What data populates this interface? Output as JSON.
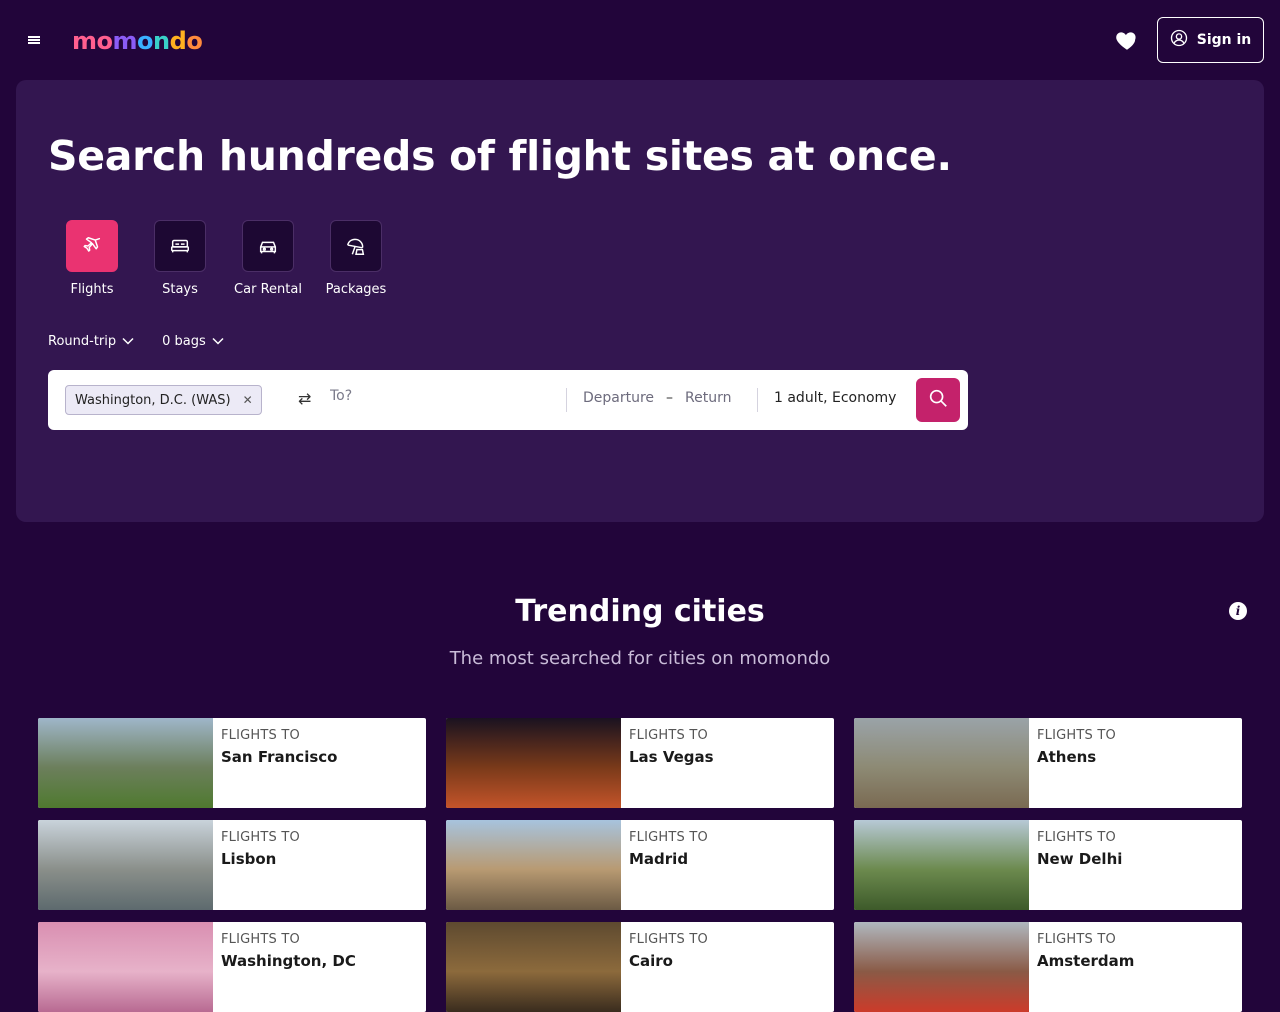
{
  "header": {
    "logo_text": "momondo",
    "logo_colors": [
      "#ff5f8f",
      "#ff5f8f",
      "#8b5cf6",
      "#3ab0ff",
      "#39d0c8",
      "#ffb020",
      "#ff8a3d"
    ],
    "signin_label": "Sign in"
  },
  "hero": {
    "title": "Search hundreds of flight sites at once.",
    "verticals": [
      {
        "label": "Flights",
        "icon": "plane-icon",
        "active": true
      },
      {
        "label": "Stays",
        "icon": "bed-icon",
        "active": false
      },
      {
        "label": "Car Rental",
        "icon": "car-icon",
        "active": false
      },
      {
        "label": "Packages",
        "icon": "beach-umbrella-icon",
        "active": false
      }
    ],
    "trip_type": "Round-trip",
    "bags": "0 bags",
    "search": {
      "origin": "Washington, D.C. (WAS)",
      "destination_placeholder": "To?",
      "departure_placeholder": "Departure",
      "dash": "–",
      "return_placeholder": "Return",
      "travelers": "1 adult, Economy"
    }
  },
  "trending": {
    "title": "Trending cities",
    "subtitle": "The most searched for cities on momondo",
    "info_glyph": "i",
    "card_label": "FLIGHTS TO",
    "cities": [
      {
        "name": "San Francisco",
        "colors": [
          "#9fb6c9",
          "#6c7f5c",
          "#4f7a2f"
        ]
      },
      {
        "name": "Las Vegas",
        "colors": [
          "#1a1220",
          "#7a3a1a",
          "#c4542a"
        ]
      },
      {
        "name": "Athens",
        "colors": [
          "#9aa3a8",
          "#8d8a74",
          "#7a6a52"
        ]
      },
      {
        "name": "Lisbon",
        "colors": [
          "#c9d3db",
          "#8a8f8a",
          "#5d6a6e"
        ]
      },
      {
        "name": "Madrid",
        "colors": [
          "#a7c3dd",
          "#b89a72",
          "#6b5a44"
        ]
      },
      {
        "name": "New Delhi",
        "colors": [
          "#b7c9d6",
          "#6c8a4e",
          "#3d5a2a"
        ]
      },
      {
        "name": "Washington, DC",
        "colors": [
          "#d98fb1",
          "#e7b2c9",
          "#b86a92"
        ]
      },
      {
        "name": "Cairo",
        "colors": [
          "#5e4a30",
          "#8c6a3c",
          "#3a2c1e"
        ]
      },
      {
        "name": "Amsterdam",
        "colors": [
          "#b0b8bf",
          "#8a5a46",
          "#cc3b2a"
        ]
      }
    ]
  }
}
